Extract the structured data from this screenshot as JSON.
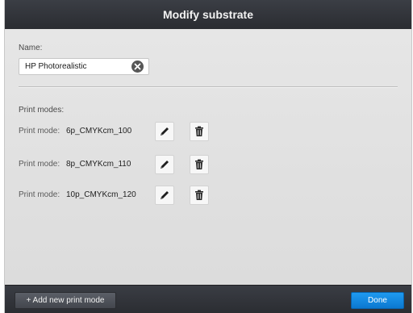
{
  "dialog": {
    "title": "Modify substrate",
    "name_label": "Name:",
    "name_value": "HP Photorealistic",
    "print_modes_label": "Print modes:",
    "print_modes": [
      {
        "prefix": "Print mode:",
        "name": "6p_CMYKcm_100"
      },
      {
        "prefix": "Print mode:",
        "name": "8p_CMYKcm_110"
      },
      {
        "prefix": "Print mode:",
        "name": "10p_CMYKcm_120"
      }
    ]
  },
  "footer": {
    "add_label": "+ Add new print mode",
    "done_label": "Done"
  },
  "icons": {
    "clear": "clear-icon",
    "edit": "pencil-icon",
    "delete": "trash-icon"
  },
  "colors": {
    "accent": "#0b78d0",
    "titlebar": "#2f3237",
    "panel": "#dedede"
  }
}
